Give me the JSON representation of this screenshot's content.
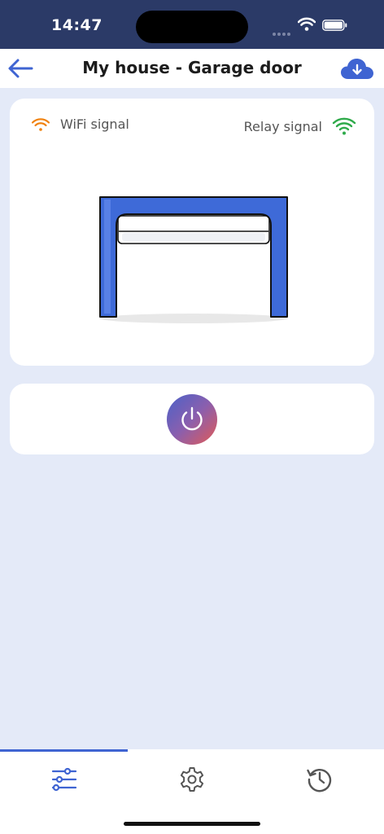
{
  "status_bar": {
    "time": "14:47"
  },
  "header": {
    "title": "My house - Garage door",
    "back_icon": "arrow-left-icon",
    "cloud_icon": "cloud-download-icon"
  },
  "door_card": {
    "wifi_label": "WiFi signal",
    "relay_label": "Relay signal",
    "wifi_color": "#f0820f",
    "relay_color": "#2eaa4a",
    "door_color": "#3e6ad8"
  },
  "power_card": {
    "icon": "power-icon"
  },
  "tabs": [
    {
      "name": "controls",
      "icon": "sliders-icon",
      "active": true
    },
    {
      "name": "settings",
      "icon": "gear-icon",
      "active": false
    },
    {
      "name": "history",
      "icon": "history-icon",
      "active": false
    }
  ],
  "colors": {
    "accent": "#3f64d2",
    "background": "#e4eaf8",
    "status_bar": "#2b3a67"
  }
}
